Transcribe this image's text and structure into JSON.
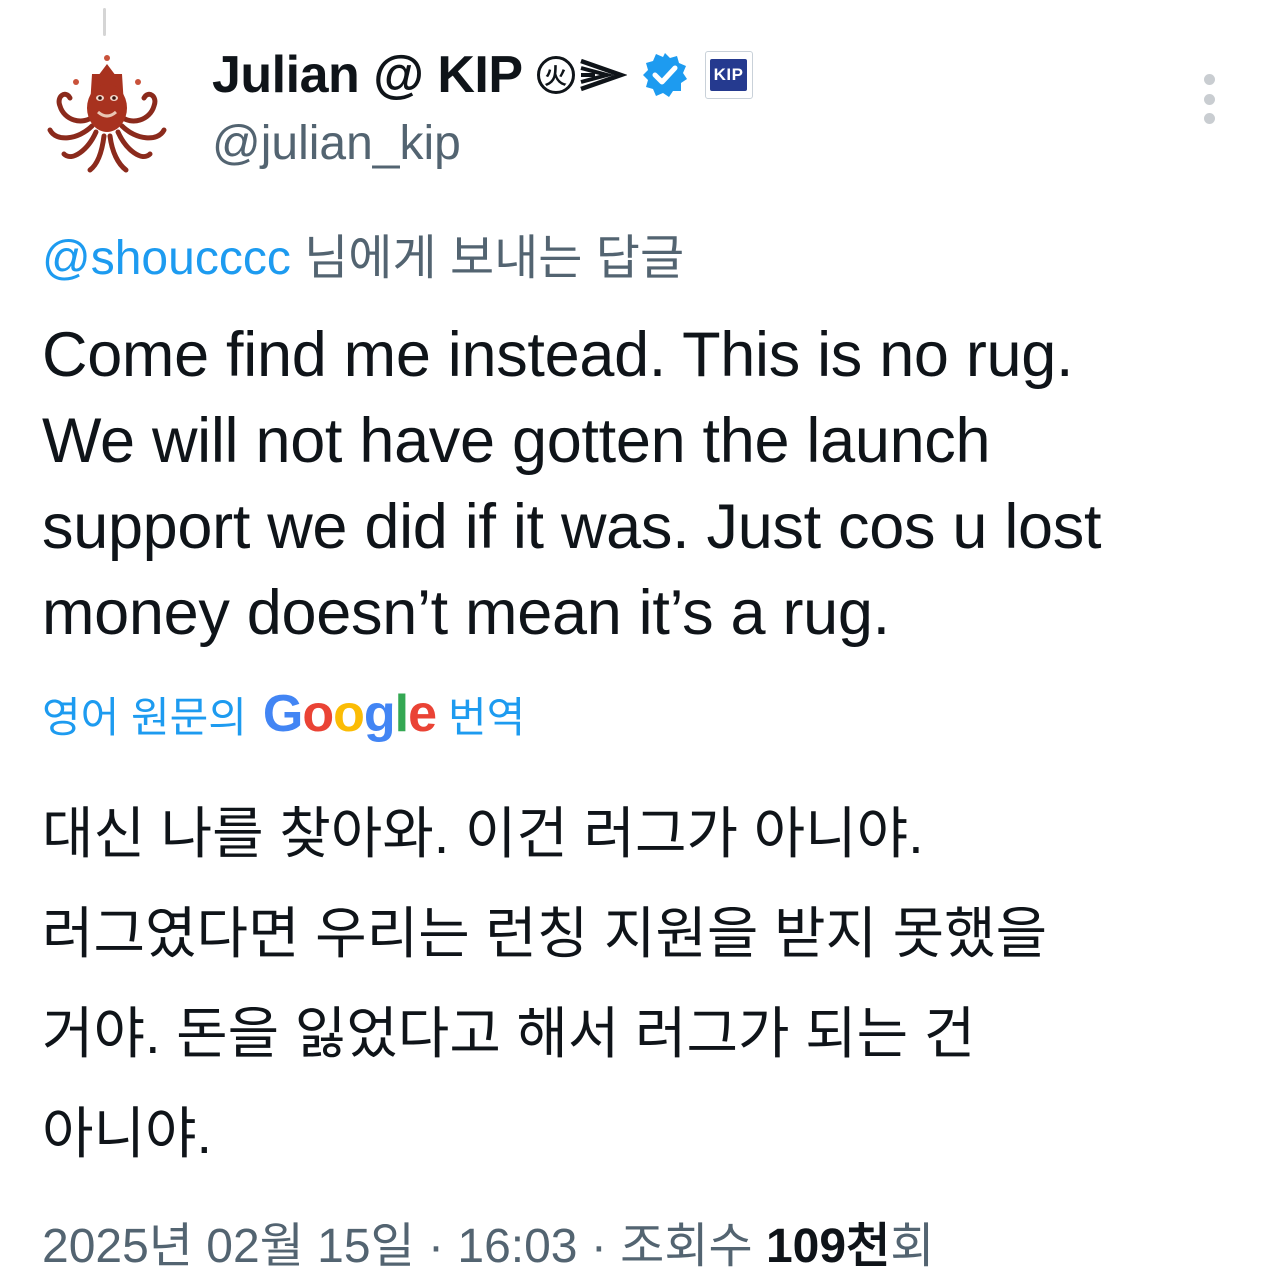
{
  "author": {
    "display_name": "Julian @ KIP",
    "handle": "@julian_kip",
    "emoji_circle": "火",
    "badge_label": "KIP"
  },
  "reply": {
    "mention": "@shoucccc",
    "suffix": " 님에게 보내는 답글"
  },
  "tweet_lines": [
    "Come find me instead. This is no rug.",
    "We will not have gotten the launch",
    "support we did if it was. Just cos u lost",
    "money doesn’t mean it’s a rug."
  ],
  "translate": {
    "prefix": "영어 원문의",
    "google": "Google",
    "suffix": "번역"
  },
  "translated_lines": [
    "대신 나를 찾아와. 이건 러그가 아니야.",
    "러그였다면 우리는 런칭 지원을 받지 못했을",
    "거야. 돈을 잃었다고 해서 러그가 되는 건",
    "아니야."
  ],
  "meta": {
    "date": "2025년 02월 15일",
    "sep1": " · ",
    "time": "16:03",
    "sep2": " · ",
    "views_label": "조회수 ",
    "views_count": "109천",
    "views_unit": "회"
  },
  "colors": {
    "accent": "#1d9bf0",
    "text": "#0f1419",
    "secondary": "#536471"
  },
  "icons": [
    "avatar-octopus",
    "emoji-fire-circle",
    "emoji-arrow",
    "verified-badge-icon",
    "kip-affiliate-badge",
    "more-options-icon"
  ]
}
